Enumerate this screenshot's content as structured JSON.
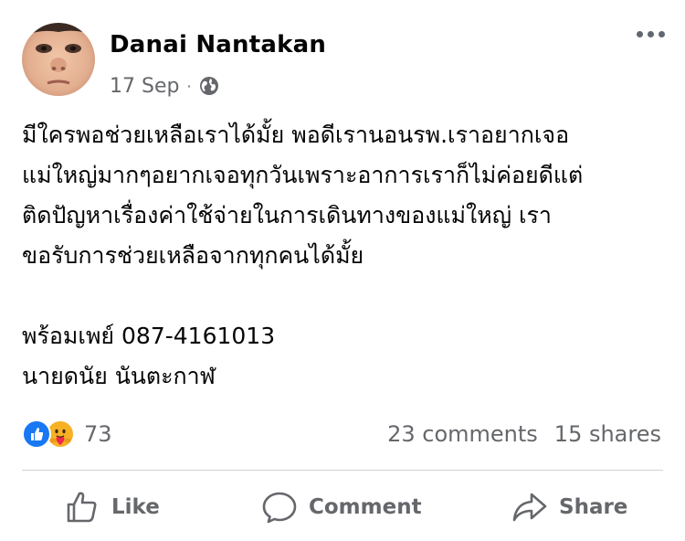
{
  "post": {
    "author_name": "Danai Nantakan",
    "date": "17 Sep",
    "separator": "·",
    "privacy_icon": "globe-icon",
    "more_icon": "more-options-icon",
    "body_lines": [
      "มีใครพอช่วยเหลือเราได้มั้ย พอดีเรานอนรพ.เราอยากเจอ",
      "แม่ใหญ่มากๆอยากเจอทุกวันเพราะอาการเราก็ไม่ค่อยดีแต่",
      "ติดปัญหาเรื่องค่าใช้จ่ายในการเดินทางของแม่ใหญ่ เรา",
      "ขอรับการช่วยเหลือจากทุกคนได้มั้ย",
      "",
      "พร้อมเพย์ 087-4161013",
      "นายดนัย  นันตะกาฬ"
    ]
  },
  "reactions": {
    "icons": [
      "like-reaction-icon",
      "care-reaction-icon"
    ],
    "count": "73",
    "comments": "23 comments",
    "shares": "15 shares"
  },
  "actions": {
    "like_label": "Like",
    "comment_label": "Comment",
    "share_label": "Share"
  },
  "colors": {
    "like_blue": "#1877f2",
    "care_yellow": "#f7b125",
    "secondary_text": "#65676b",
    "primary_text": "#050505"
  }
}
